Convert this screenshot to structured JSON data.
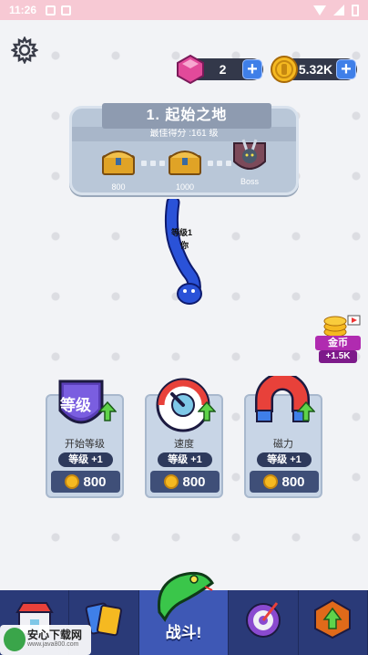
{
  "status_bar": {
    "time": "11:26"
  },
  "currency": {
    "gems": "2",
    "gold": "5.32K",
    "plus_label": "+"
  },
  "level_panel": {
    "title": "1. 起始之地",
    "best_score": "最佳得分 :161 级",
    "milestones": [
      "800",
      "1000",
      "Boss"
    ]
  },
  "snake": {
    "level_label": "等级1",
    "name_label": "你"
  },
  "side_reward": {
    "label": "金币",
    "amount": "+1.5K"
  },
  "upgrades": [
    {
      "name": "开始等级",
      "level": "等级 +1",
      "cost": "800",
      "icon": "level-shield-icon",
      "badge": "等级"
    },
    {
      "name": "速度",
      "level": "等级 +1",
      "cost": "800",
      "icon": "speedometer-icon"
    },
    {
      "name": "磁力",
      "level": "等级 +1",
      "cost": "800",
      "icon": "magnet-icon"
    }
  ],
  "bottom_nav": {
    "items": [
      "shop-icon",
      "cards-icon",
      "snake-head-icon",
      "target-icon",
      "upgrade-gem-icon"
    ],
    "battle_label": "战斗!"
  },
  "watermark": {
    "title": "安心下载网",
    "url": "www.java800.com"
  },
  "colors": {
    "accent": "#3f7fe8",
    "nav_bg": "#2a3a78",
    "nav_active": "#3e58b5",
    "card_bg": "#c8d5e6",
    "gem": "#e24a9a",
    "gold": "#f5b921"
  }
}
